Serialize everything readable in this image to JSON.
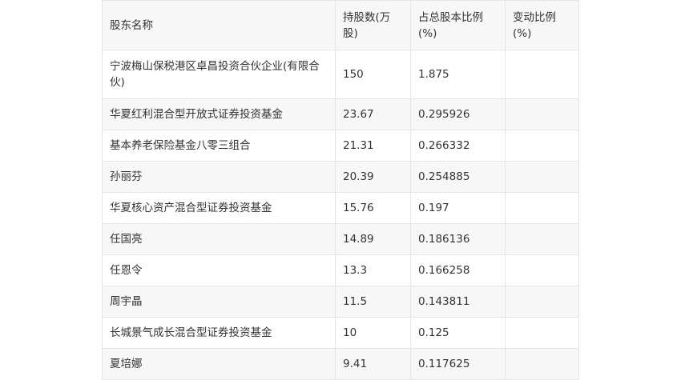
{
  "table": {
    "headers": [
      "股东名称",
      "持股数(万股)",
      "占总股本比例(%)",
      "变动比例(%)"
    ],
    "rows": [
      [
        "宁波梅山保税港区卓昌投资合伙企业(有限合伙)",
        "150",
        "1.875",
        ""
      ],
      [
        "华夏红利混合型开放式证券投资基金",
        "23.67",
        "0.295926",
        ""
      ],
      [
        "基本养老保险基金八零三组合",
        "21.31",
        "0.266332",
        ""
      ],
      [
        "孙丽芬",
        "20.39",
        "0.254885",
        ""
      ],
      [
        "华夏核心资产混合型证券投资基金",
        "15.76",
        "0.197",
        ""
      ],
      [
        "任国亮",
        "14.89",
        "0.186136",
        ""
      ],
      [
        "任恩令",
        "13.3",
        "0.166258",
        ""
      ],
      [
        "周宇晶",
        "11.5",
        "0.143811",
        ""
      ],
      [
        "长城景气成长混合型证券投资基金",
        "10",
        "0.125",
        ""
      ],
      [
        "夏培娜",
        "9.41",
        "0.117625",
        ""
      ]
    ]
  }
}
